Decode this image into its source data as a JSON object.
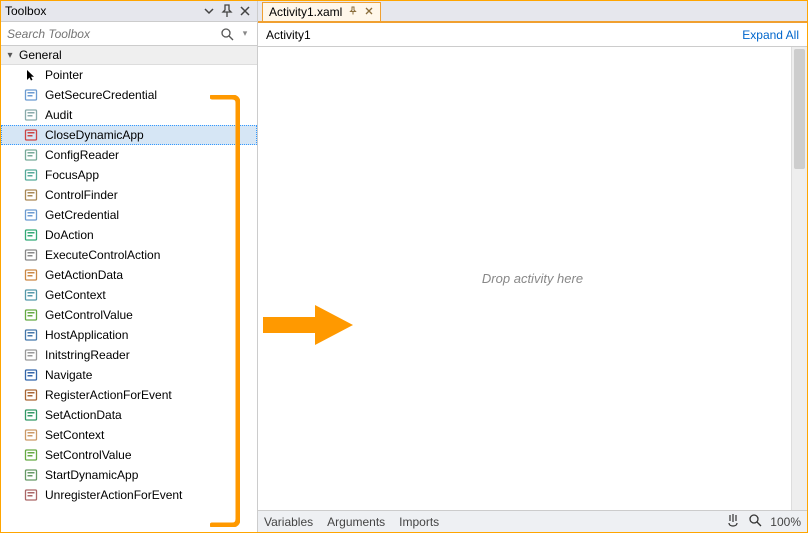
{
  "toolbox": {
    "title": "Toolbox",
    "search_placeholder": "Search Toolbox",
    "group_label": "General",
    "selected_index": 3,
    "items": [
      {
        "label": "Pointer",
        "icon": "cursor-icon"
      },
      {
        "label": "GetSecureCredential",
        "icon": "form-icon"
      },
      {
        "label": "Audit",
        "icon": "checklist-icon"
      },
      {
        "label": "CloseDynamicApp",
        "icon": "close-app-icon"
      },
      {
        "label": "ConfigReader",
        "icon": "config-icon"
      },
      {
        "label": "FocusApp",
        "icon": "focus-icon"
      },
      {
        "label": "ControlFinder",
        "icon": "finder-icon"
      },
      {
        "label": "GetCredential",
        "icon": "form-icon"
      },
      {
        "label": "DoAction",
        "icon": "action-icon"
      },
      {
        "label": "ExecuteControlAction",
        "icon": "execute-icon"
      },
      {
        "label": "GetActionData",
        "icon": "getdata-icon"
      },
      {
        "label": "GetContext",
        "icon": "context-icon"
      },
      {
        "label": "GetControlValue",
        "icon": "getvalue-icon"
      },
      {
        "label": "HostApplication",
        "icon": "host-icon"
      },
      {
        "label": "InitstringReader",
        "icon": "text-icon"
      },
      {
        "label": "Navigate",
        "icon": "navigate-icon"
      },
      {
        "label": "RegisterActionForEvent",
        "icon": "register-icon"
      },
      {
        "label": "SetActionData",
        "icon": "setdata-icon"
      },
      {
        "label": "SetContext",
        "icon": "setcontext-icon"
      },
      {
        "label": "SetControlValue",
        "icon": "setvalue-icon"
      },
      {
        "label": "StartDynamicApp",
        "icon": "start-icon"
      },
      {
        "label": "UnregisterActionForEvent",
        "icon": "unregister-icon"
      }
    ]
  },
  "designer": {
    "tab_label": "Activity1.xaml",
    "breadcrumb": "Activity1",
    "expand_all": "Expand All",
    "drop_hint": "Drop activity here",
    "bottom": {
      "variables": "Variables",
      "arguments": "Arguments",
      "imports": "Imports",
      "zoom": "100%"
    }
  }
}
